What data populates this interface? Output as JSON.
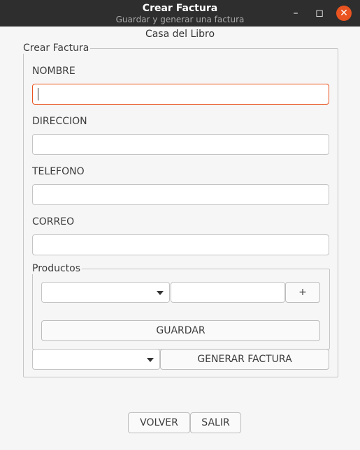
{
  "window": {
    "title": "Crear Factura",
    "subtitle": "Guardar y generar una factura",
    "minimize_icon": "minimize-icon",
    "maximize_icon": "maximize-icon",
    "close_icon": "close-icon",
    "min_glyph": "–",
    "max_glyph": "◻",
    "close_glyph": "✕",
    "accent": "#e95420"
  },
  "app_title": "Casa del Libro",
  "form": {
    "group_title": "Crear Factura",
    "nombre_label": "NOMBRE",
    "direccion_label": "DIRECCION",
    "telefono_label": "TELEFONO",
    "correo_label": "CORREO",
    "nombre_value": "",
    "direccion_value": "",
    "telefono_value": "",
    "correo_value": ""
  },
  "productos": {
    "group_title": "Productos",
    "product_select_value": "",
    "quantity_value": "",
    "add_label": "+",
    "guardar_label": "GUARDAR"
  },
  "factura": {
    "select_value": "",
    "generar_label": "GENERAR FACTURA"
  },
  "footer": {
    "volver_label": "VOLVER",
    "salir_label": "SALIR"
  }
}
